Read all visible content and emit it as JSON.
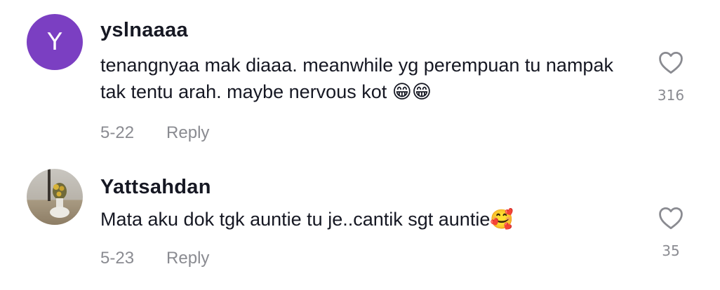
{
  "comments": [
    {
      "avatar_letter": "Y",
      "avatar_color": "#7b3fc2",
      "username": "yslnaaaa",
      "text": "tenangnyaa mak diaaa. meanwhile yg perempuan tu nampak tak tentu arah. maybe nervous kot 😁😁",
      "date": "5-22",
      "reply_label": "Reply",
      "likes": "316",
      "like_icon": "heart-outline-icon"
    },
    {
      "avatar_image": "profile-photo",
      "username": "Yattsahdan",
      "text": "Mata aku dok tgk auntie tu je..cantik sgt auntie🥰",
      "date": "5-23",
      "reply_label": "Reply",
      "likes": "35",
      "like_icon": "heart-outline-icon"
    }
  ]
}
